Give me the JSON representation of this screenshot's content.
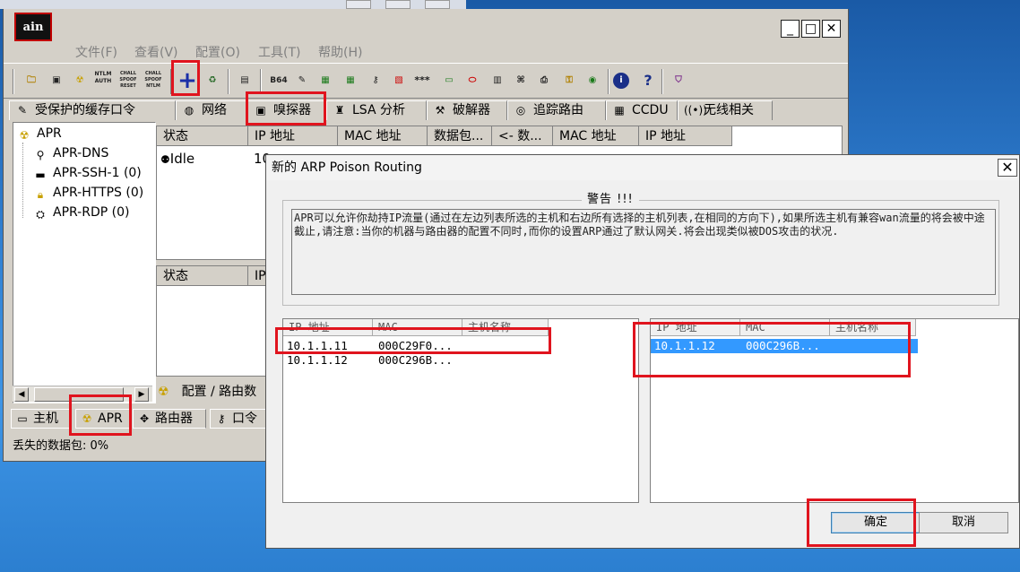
{
  "cain": {
    "logo": "ain",
    "menu": [
      "文件(F)",
      "查看(V)",
      "配置(O)",
      "工具(T)",
      "帮助(H)"
    ],
    "tabs": [
      "受保护的缓存口令",
      "网络",
      "嗅探器",
      "LSA 分析",
      "破解器",
      "追踪路由",
      "CCDU",
      "无线相关"
    ],
    "tree": {
      "root": "APR",
      "items": [
        "APR-DNS",
        "APR-SSH-1 (0)",
        "APR-HTTPS (0)",
        "APR-RDP (0)"
      ]
    },
    "top_list": {
      "headers": [
        "状态",
        "IP 地址",
        "MAC 地址",
        "数据包...",
        "<- 数...",
        "MAC 地址",
        "IP 地址"
      ],
      "row_status": "Idle",
      "row_ip": "10"
    },
    "bottom_list": {
      "headers": [
        "状态",
        "IP"
      ]
    },
    "config_route": "配置 / 路由数",
    "bottom_tabs": [
      "主机",
      "APR",
      "路由器",
      "口令"
    ],
    "status": "丢失的数据包:  0%",
    "toolbar_text": {
      "b64": "B64",
      "ntlm": "NTLM AUTH",
      "chal1": "CHALL SPOOF RESET",
      "chal2": "CHALL SPOOF NTLM",
      "stars": "***"
    }
  },
  "dialog": {
    "title": "新的 ARP Poison Routing",
    "warning_label": "警告 !!!",
    "warning_text": "APR可以允许你劫持IP流量(通过在左边列表所选的主机和右边所有选择的主机列表,在相同的方向下),如果所选主机有兼容wan流量的将会被中途截止,请注意:当你的机器与路由器的配置不同时,而你的设置ARP通过了默认网关.将会出现类似被DOS攻击的状况.",
    "left_table": {
      "headers": [
        "IP 地址",
        "MAC",
        "主机名称"
      ],
      "rows": [
        {
          "ip": "10.1.1.11",
          "mac": "000C29F0..."
        },
        {
          "ip": "10.1.1.12",
          "mac": "000C296B..."
        }
      ]
    },
    "right_table": {
      "headers": [
        "IP 地址",
        "MAC",
        "主机名称"
      ],
      "rows": [
        {
          "ip": "10.1.1.12",
          "mac": "000C296B...",
          "selected": true
        }
      ]
    },
    "ok": "确定",
    "cancel": "取消"
  }
}
